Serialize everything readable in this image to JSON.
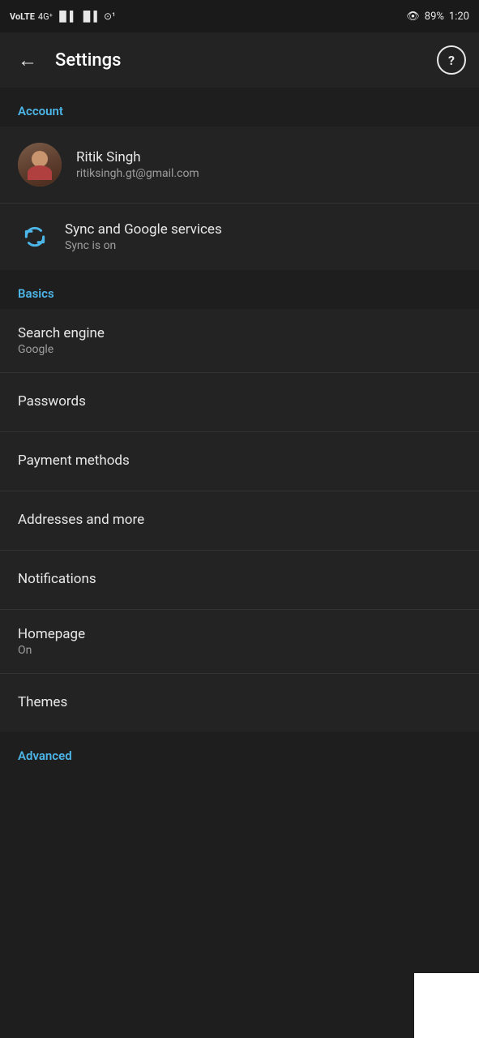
{
  "statusBar": {
    "time": "1:20",
    "batteryPercent": "89",
    "signal1": "4G+",
    "signal2": "wifi"
  },
  "appBar": {
    "title": "Settings",
    "helpLabel": "?"
  },
  "sections": {
    "account": {
      "label": "Account",
      "user": {
        "name": "Ritik Singh",
        "email": "ritiksingh.gt@gmail.com"
      },
      "syncItem": {
        "title": "Sync and Google services",
        "subtitle": "Sync is on"
      }
    },
    "basics": {
      "label": "Basics",
      "items": [
        {
          "title": "Search engine",
          "subtitle": "Google"
        },
        {
          "title": "Passwords",
          "subtitle": ""
        },
        {
          "title": "Payment methods",
          "subtitle": ""
        },
        {
          "title": "Addresses and more",
          "subtitle": ""
        },
        {
          "title": "Notifications",
          "subtitle": ""
        },
        {
          "title": "Homepage",
          "subtitle": "On"
        },
        {
          "title": "Themes",
          "subtitle": ""
        }
      ]
    },
    "advanced": {
      "label": "Advanced"
    }
  }
}
